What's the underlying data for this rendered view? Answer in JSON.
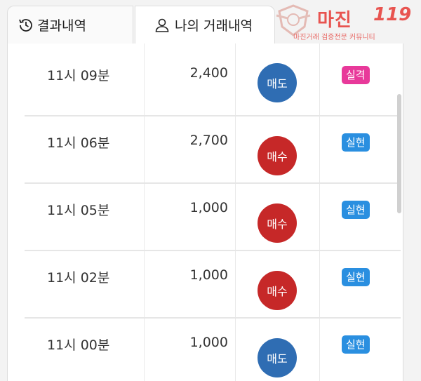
{
  "tabs": {
    "results": {
      "label": "결과내역",
      "icon": "history-icon"
    },
    "my_trades": {
      "label": "나의 거래내역",
      "icon": "user-icon"
    }
  },
  "watermark": {
    "main": "마진",
    "number": "119",
    "subtitle": "마진거래 검증전문 커뮤니티"
  },
  "trades": [
    {
      "time": "11시 09분",
      "amount": "2,400",
      "side": "매도",
      "result": "실격"
    },
    {
      "time": "11시 06분",
      "amount": "2,700",
      "side": "매수",
      "result": "실현"
    },
    {
      "time": "11시 05분",
      "amount": "1,000",
      "side": "매수",
      "result": "실현"
    },
    {
      "time": "11시 02분",
      "amount": "1,000",
      "side": "매수",
      "result": "실현"
    },
    {
      "time": "11시 00분",
      "amount": "1,000",
      "side": "매도",
      "result": "실현"
    }
  ],
  "colors": {
    "sell": "#2f6db3",
    "buy": "#c62828",
    "fail": "#e8399a",
    "success": "#2a8fe0",
    "logo": "#e85450"
  }
}
